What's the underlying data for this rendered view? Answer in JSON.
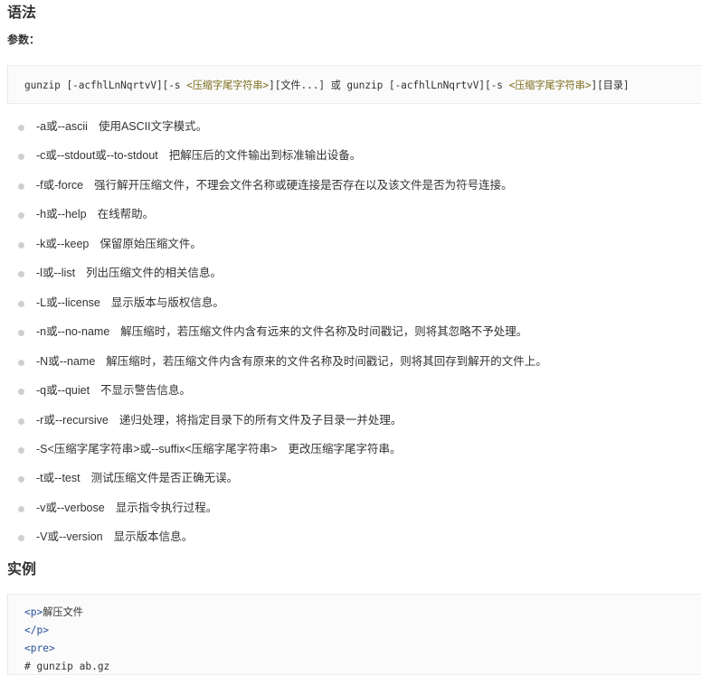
{
  "headings": {
    "syntax": "语法",
    "example": "实例"
  },
  "params_label": "参数：",
  "syntax_code": {
    "part1": "gunzip [-acfhlLnNqrtvV][-s ",
    "suffix1": "<压缩字尾字符串>",
    "part2": "][文件...] 或 gunzip [-acfhlLnNqrtvV][-s ",
    "suffix2": "<压缩字尾字符串>",
    "part3": "][目录]"
  },
  "options": [
    {
      "opt": "-a或--ascii",
      "desc": "使用ASCII文字模式。"
    },
    {
      "opt": "-c或--stdout或--to-stdout",
      "desc": "把解压后的文件输出到标准输出设备。"
    },
    {
      "opt": "-f或-force",
      "desc": "强行解开压缩文件，不理会文件名称或硬连接是否存在以及该文件是否为符号连接。"
    },
    {
      "opt": "-h或--help",
      "desc": "在线帮助。"
    },
    {
      "opt": "-k或--keep",
      "desc": "保留原始压缩文件。"
    },
    {
      "opt": "-l或--list",
      "desc": "列出压缩文件的相关信息。"
    },
    {
      "opt": "-L或--license",
      "desc": "显示版本与版权信息。"
    },
    {
      "opt": "-n或--no-name",
      "desc": "解压缩时，若压缩文件内含有远来的文件名称及时间戳记，则将其忽略不予处理。"
    },
    {
      "opt": "-N或--name",
      "desc": "解压缩时，若压缩文件内含有原来的文件名称及时间戳记，则将其回存到解开的文件上。"
    },
    {
      "opt": "-q或--quiet",
      "desc": "不显示警告信息。"
    },
    {
      "opt": "-r或--recursive",
      "desc": "递归处理，将指定目录下的所有文件及子目录一并处理。"
    },
    {
      "opt": "-S<压缩字尾字符串>或--suffix<压缩字尾字符串>",
      "desc": "更改压缩字尾字符串。"
    },
    {
      "opt": "-t或--test",
      "desc": "测试压缩文件是否正确无误。"
    },
    {
      "opt": "-v或--verbose",
      "desc": "显示指令执行过程。"
    },
    {
      "opt": "-V或--version",
      "desc": "显示版本信息。"
    }
  ],
  "example_code": {
    "l1_tag": "<p>",
    "l1_text": "解压文件",
    "l2_tag": "</p>",
    "l3_tag": "<pre>",
    "l4_text": "# gunzip ab.gz"
  }
}
